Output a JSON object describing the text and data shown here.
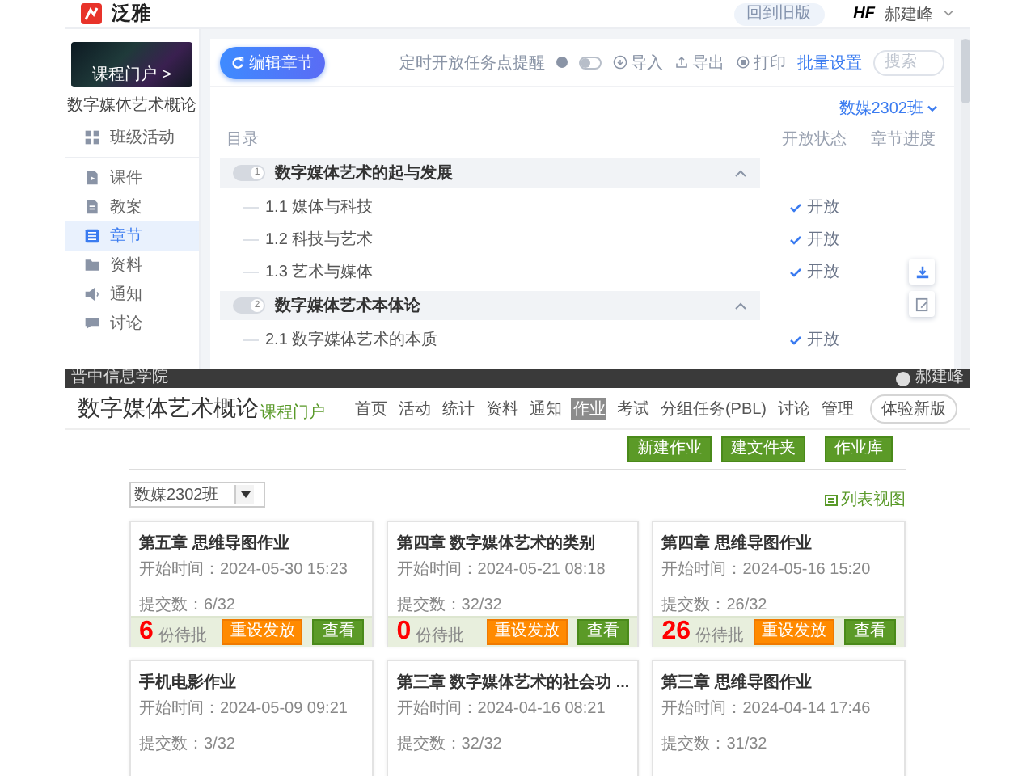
{
  "top": {
    "brand": "泛雅",
    "old_version_button": "回到旧版",
    "user_logo": "HF",
    "user": "郝建峰",
    "sidebar": {
      "cover_label": "课程门户 >",
      "course_title": "数字媒体艺术概论",
      "items": [
        {
          "label": "班级活动",
          "selected": false
        },
        {
          "label": "课件",
          "selected": false
        },
        {
          "label": "教案",
          "selected": false
        },
        {
          "label": "章节",
          "selected": true
        },
        {
          "label": "资料",
          "selected": false
        },
        {
          "label": "通知",
          "selected": false
        },
        {
          "label": "讨论",
          "selected": false
        }
      ]
    },
    "toolbar": {
      "edit_button": "编辑章节",
      "reminder_label": "定时开放任务点提醒",
      "reminder_on": false,
      "actions": [
        "导入",
        "导出",
        "打印"
      ],
      "batch_link": "批量设置",
      "search": {
        "placeholder": "搜索"
      }
    },
    "tree": {
      "heading": "目录",
      "chapters": [
        {
          "number": "1",
          "title": "数字媒体艺术的起与发展",
          "expanded": true,
          "children": [
            {
              "title": "1.1 媒体与科技",
              "status": "开放"
            },
            {
              "title": "1.2 科技与艺术",
              "status": "开放"
            },
            {
              "title": "1.3 艺术与媒体",
              "status": "开放"
            }
          ]
        },
        {
          "number": "2",
          "title": "数字媒体艺术本体论",
          "expanded": true,
          "children": [
            {
              "title": "2.1 数字媒体艺术的本质",
              "status": "开放"
            }
          ]
        }
      ]
    },
    "panel": {
      "class_selector": "数媒2302班",
      "columns": [
        "开放状态",
        "章节进度"
      ]
    }
  },
  "bottom": {
    "school": "晋中信息学院",
    "user": "郝建峰",
    "course_title": "数字媒体艺术概论",
    "portal_link": "课程门户",
    "nav": [
      {
        "label": "首页",
        "selected": false
      },
      {
        "label": "活动",
        "selected": false
      },
      {
        "label": "统计",
        "selected": false
      },
      {
        "label": "资料",
        "selected": false
      },
      {
        "label": "通知",
        "selected": false
      },
      {
        "label": "作业",
        "selected": true
      },
      {
        "label": "考试",
        "selected": false
      },
      {
        "label": "分组任务(PBL)",
        "selected": false
      },
      {
        "label": "讨论",
        "selected": false
      },
      {
        "label": "管理",
        "selected": false
      }
    ],
    "new_version_button": "体验新版",
    "actions": [
      "新建作业",
      "建文件夹",
      "作业库"
    ],
    "class_dropdown": "数媒2302班",
    "view_link": "列表视图",
    "cards": [
      {
        "title": "第五章 思维导图作业",
        "start": "开始时间：2024-05-30 15:23",
        "submitted": "提交数：6/32",
        "pending": "6",
        "pending_label": "份待批",
        "reset_button": "重设发放",
        "view_button": "查看"
      },
      {
        "title": "第四章 数字媒体艺术的类别",
        "start": "开始时间：2024-05-21 08:18",
        "submitted": "提交数：32/32",
        "pending": "0",
        "pending_label": "份待批",
        "reset_button": "重设发放",
        "view_button": "查看"
      },
      {
        "title": "第四章 思维导图作业",
        "start": "开始时间：2024-05-16 15:20",
        "submitted": "提交数：26/32",
        "pending": "26",
        "pending_label": "份待批",
        "reset_button": "重设发放",
        "view_button": "查看"
      },
      {
        "title": "手机电影作业",
        "start": "开始时间：2024-05-09 09:21",
        "submitted": "提交数：3/32"
      },
      {
        "title": "第三章 数字媒体艺术的社会功 ...",
        "start": "开始时间：2024-04-16 08:21",
        "submitted": "提交数：32/32"
      },
      {
        "title": "第三章 思维导图作业",
        "start": "开始时间：2024-04-14 17:46",
        "submitted": "提交数：31/32"
      }
    ]
  }
}
